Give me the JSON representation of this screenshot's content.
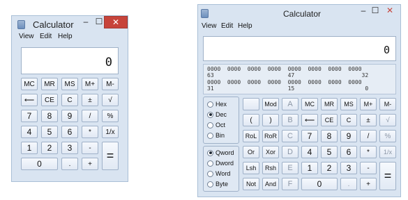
{
  "left_window": {
    "title": "Calculator",
    "controls": {
      "minimize": "–",
      "maximize": "☐",
      "close": "✕"
    },
    "menu": [
      "View",
      "Edit",
      "Help"
    ],
    "display": "0",
    "keys": {
      "mc": "MC",
      "mr": "MR",
      "ms": "MS",
      "mplus": "M+",
      "mminus": "M-",
      "back": "⟵",
      "ce": "CE",
      "c": "C",
      "plusminus": "±",
      "sqrt": "√",
      "seven": "7",
      "eight": "8",
      "nine": "9",
      "div": "/",
      "pct": "%",
      "four": "4",
      "five": "5",
      "six": "6",
      "mul": "*",
      "recip": "1/x",
      "one": "1",
      "two": "2",
      "three": "3",
      "sub": "-",
      "equals": "=",
      "zero": "0",
      "dot": ".",
      "add": "+"
    }
  },
  "right_window": {
    "title": "Calculator",
    "controls": {
      "minimize": "–",
      "maximize": "☐",
      "close": "✕"
    },
    "menu": [
      "View",
      "Edit",
      "Help"
    ],
    "display": "0",
    "bit_rows": [
      "0000  0000  0000  0000  0000  0000  0000  0000",
      "63                      47                    32",
      "0000  0000  0000  0000  0000  0000  0000  0000",
      "31                      15                     0"
    ],
    "base_options": [
      "Hex",
      "Dec",
      "Oct",
      "Bin"
    ],
    "base_selected": "Dec",
    "word_options": [
      "Qword",
      "Dword",
      "Word",
      "Byte"
    ],
    "word_selected": "Qword",
    "keys": {
      "blank": "",
      "mod": "Mod",
      "a": "A",
      "mc": "MC",
      "mr": "MR",
      "ms": "MS",
      "mplus": "M+",
      "mminus": "M-",
      "lparen": "(",
      "rparen": ")",
      "b": "B",
      "back": "⟵",
      "ce": "CE",
      "c": "C",
      "plusminus": "±",
      "sqrt": "√",
      "rol": "RoL",
      "ror": "RoR",
      "cc": "C",
      "seven": "7",
      "eight": "8",
      "nine": "9",
      "div": "/",
      "pct": "%",
      "or": "Or",
      "xor": "Xor",
      "d": "D",
      "four": "4",
      "five": "5",
      "six": "6",
      "mul": "*",
      "recip": "1/x",
      "lsh": "Lsh",
      "rsh": "Rsh",
      "e": "E",
      "one": "1",
      "two": "2",
      "three": "3",
      "sub": "-",
      "equals": "=",
      "not": "Not",
      "and": "And",
      "f": "F",
      "zero": "0",
      "dot": ".",
      "add": "+"
    }
  }
}
